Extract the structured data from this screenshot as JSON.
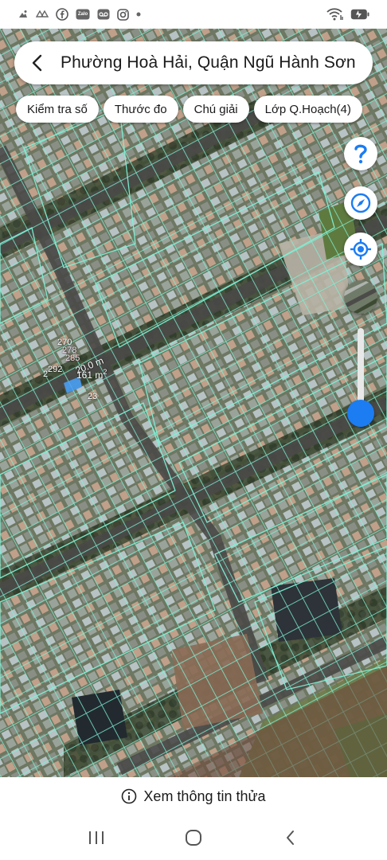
{
  "status_bar": {
    "icons": [
      "photos-icon",
      "sos-icon",
      "facebook-icon",
      "zalo-icon",
      "voicemail-icon",
      "instagram-icon",
      "dot-icon"
    ],
    "zalo_text": "Zalo",
    "right_icons": [
      "wifi-icon",
      "battery-icon"
    ]
  },
  "header": {
    "back_icon": "chevron-left-icon",
    "title": "Phường Hoà Hải, Quận Ngũ Hành Sơn"
  },
  "chips": [
    {
      "label": "Kiểm tra số"
    },
    {
      "label": "Thước đo"
    },
    {
      "label": "Chú giải"
    },
    {
      "label": "Lớp Q.Hoạch(4)"
    }
  ],
  "map_buttons": {
    "help_icon": "question-icon",
    "compass_icon": "compass-icon",
    "locate_icon": "crosshair-icon",
    "layer_icon": "satellite-layer-icon",
    "opacity_level": 0.14
  },
  "map_labels": {
    "parcel_270": "270",
    "parcel_278": "278",
    "parcel_285": "285",
    "parcel_292": "292",
    "parcel_2": "2",
    "parcel_23": "23",
    "measure_length": "20.0 m",
    "measure_area": "161 m",
    "measure_area_sup": "2"
  },
  "info_bar": {
    "icon": "info-icon",
    "label": "Xem thông tin thửa"
  },
  "nav_bar": {
    "icons": [
      "recent-apps-icon",
      "home-icon",
      "back-icon"
    ]
  },
  "colors": {
    "accent": "#1c7cf2",
    "parcel_lines": "#7ef2d6"
  }
}
